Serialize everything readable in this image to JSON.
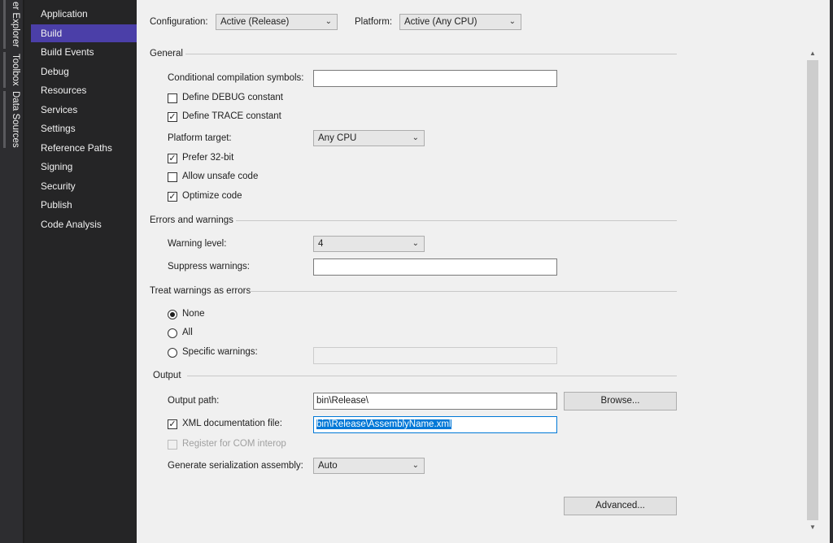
{
  "side_tabs": [
    "er Explorer",
    "Toolbox",
    "Data Sources"
  ],
  "nav": {
    "items": [
      "Application",
      "Build",
      "Build Events",
      "Debug",
      "Resources",
      "Services",
      "Settings",
      "Reference Paths",
      "Signing",
      "Security",
      "Publish",
      "Code Analysis"
    ],
    "selected": "Build"
  },
  "header": {
    "config_label": "Configuration:",
    "config_value": "Active (Release)",
    "platform_label": "Platform:",
    "platform_value": "Active (Any CPU)"
  },
  "general": {
    "title": "General",
    "cond_symbols_label": "Conditional compilation symbols:",
    "cond_symbols_value": "",
    "define_debug": "Define DEBUG constant",
    "define_trace": "Define TRACE constant",
    "platform_target_label": "Platform target:",
    "platform_target_value": "Any CPU",
    "prefer32": "Prefer 32-bit",
    "unsafe": "Allow unsafe code",
    "optimize": "Optimize code",
    "checked": {
      "define_debug": false,
      "define_trace": true,
      "prefer32": true,
      "unsafe": false,
      "optimize": true
    }
  },
  "errors": {
    "title": "Errors and warnings",
    "warning_level_label": "Warning level:",
    "warning_level_value": "4",
    "suppress_label": "Suppress warnings:",
    "suppress_value": ""
  },
  "treat": {
    "title": "Treat warnings as errors",
    "none": "None",
    "all": "All",
    "specific": "Specific warnings:",
    "specific_value": "",
    "selected": "none"
  },
  "output": {
    "title": "Output",
    "path_label": "Output path:",
    "path_value": "bin\\Release\\",
    "browse": "Browse...",
    "xml_label": "XML documentation file:",
    "xml_value": "bin\\Release\\AssemblyName.xml",
    "com_label": "Register for COM interop",
    "serial_label": "Generate serialization assembly:",
    "serial_value": "Auto",
    "advanced": "Advanced..."
  }
}
